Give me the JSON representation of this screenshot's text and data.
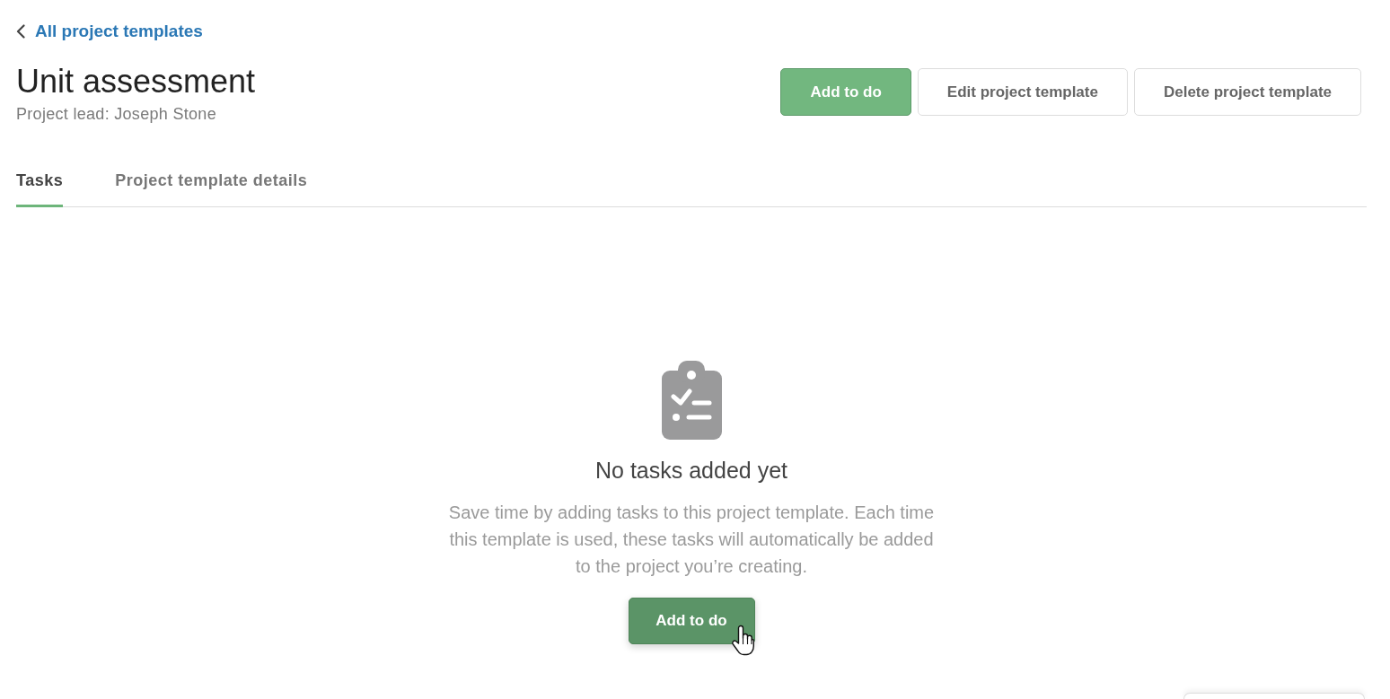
{
  "back_link": {
    "label": "All project templates"
  },
  "header": {
    "title": "Unit assessment",
    "subtitle": "Project lead: Joseph Stone"
  },
  "actions": [
    {
      "label": "Add to do",
      "kind": "primary"
    },
    {
      "label": "Edit project template",
      "kind": "secondary"
    },
    {
      "label": "Delete project template",
      "kind": "secondary"
    }
  ],
  "tabs": [
    {
      "label": "Tasks",
      "selected": true
    },
    {
      "label": "Project template details",
      "selected": false
    }
  ],
  "empty_state": {
    "title": "No tasks added yet",
    "message": "Save time by adding tasks to this project template. Each time this template is used, these tasks will automatically be added to the project you’re creating.",
    "button": {
      "label": "Add to do",
      "hovered": true
    }
  }
}
